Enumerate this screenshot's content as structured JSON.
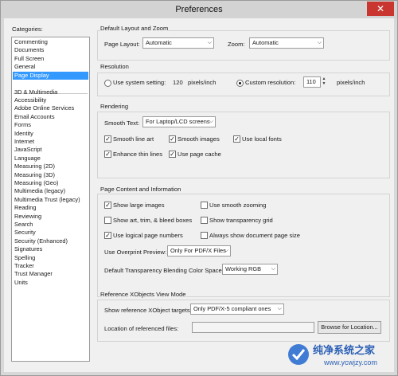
{
  "window": {
    "title": "Preferences"
  },
  "sidebar": {
    "label": "Categories:",
    "top_items": [
      "Commenting",
      "Documents",
      "Full Screen",
      "General",
      "Page Display"
    ],
    "items": [
      "3D & Multimedia",
      "Accessibility",
      "Adobe Online Services",
      "Email Accounts",
      "Forms",
      "Identity",
      "Internet",
      "JavaScript",
      "Language",
      "Measuring (2D)",
      "Measuring (3D)",
      "Measuring (Geo)",
      "Multimedia (legacy)",
      "Multimedia Trust (legacy)",
      "Reading",
      "Reviewing",
      "Search",
      "Security",
      "Security (Enhanced)",
      "Signatures",
      "Spelling",
      "Tracker",
      "Trust Manager",
      "Units"
    ],
    "selected": "Page Display"
  },
  "layout_zoom": {
    "title": "Default Layout and Zoom",
    "page_layout_label": "Page Layout:",
    "page_layout_value": "Automatic",
    "zoom_label": "Zoom:",
    "zoom_value": "Automatic"
  },
  "resolution": {
    "title": "Resolution",
    "system_label": "Use system setting:",
    "system_value": "120",
    "system_unit": "pixels/inch",
    "custom_label": "Custom resolution:",
    "custom_value": "110",
    "custom_unit": "pixels/inch",
    "selected": "custom"
  },
  "rendering": {
    "title": "Rendering",
    "smooth_text_label": "Smooth Text:",
    "smooth_text_value": "For Laptop/LCD screens",
    "smooth_line_art": "Smooth line art",
    "smooth_images": "Smooth images",
    "use_local_fonts": "Use local fonts",
    "enhance_thin_lines": "Enhance thin lines",
    "use_page_cache": "Use page cache",
    "checked": {
      "smooth_line_art": true,
      "smooth_images": true,
      "use_local_fonts": true,
      "enhance_thin_lines": true,
      "use_page_cache": true
    }
  },
  "page_content": {
    "title": "Page Content and Information",
    "show_large_images": "Show large images",
    "use_smooth_zooming": "Use smooth zooming",
    "show_art_trim": "Show art, trim, & bleed boxes",
    "show_transparency_grid": "Show transparency grid",
    "use_logical_page_numbers": "Use logical page numbers",
    "always_show_page_size": "Always show document page size",
    "checked": {
      "show_large_images": true,
      "use_smooth_zooming": false,
      "show_art_trim": false,
      "show_transparency_grid": false,
      "use_logical_page_numbers": true,
      "always_show_page_size": false
    },
    "overprint_label": "Use Overprint Preview:",
    "overprint_value": "Only For PDF/X Files",
    "blending_label": "Default Transparency Blending Color Space:",
    "blending_value": "Working RGB"
  },
  "xobjects": {
    "title": "Reference XObjects View Mode",
    "targets_label": "Show reference XObject targets:",
    "targets_value": "Only PDF/X-5 compliant ones",
    "location_label": "Location of referenced files:",
    "location_value": "",
    "browse_label": "Browse for Location..."
  },
  "watermark": {
    "brand": "纯净系统之家",
    "url": "www.ycwjzy.com"
  },
  "colors": {
    "selection": "#3399ff",
    "close_button": "#c8362f",
    "panel_bg": "#f0f0f0"
  }
}
